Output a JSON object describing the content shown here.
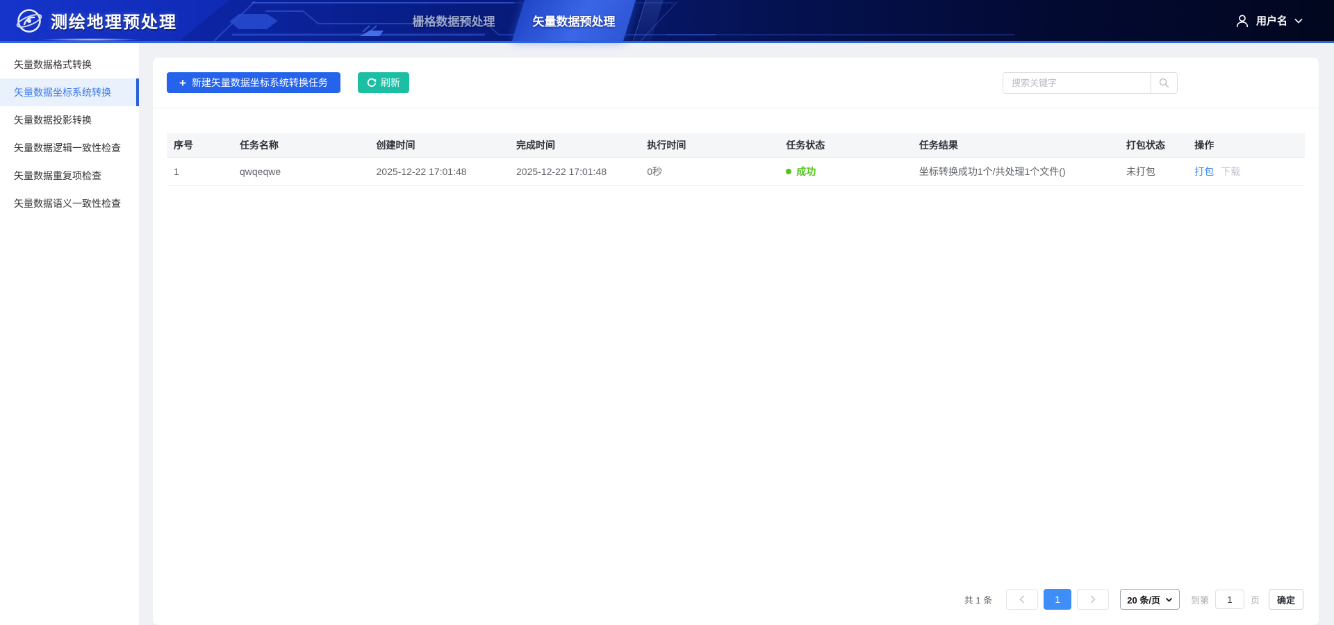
{
  "header": {
    "app_title": "测绘地理预处理",
    "tabs": [
      {
        "label": "栅格数据预处理"
      },
      {
        "label": "矢量数据预处理"
      }
    ],
    "username": "用户名"
  },
  "sidebar": {
    "active_index": 1,
    "items": [
      {
        "label": "矢量数据格式转换"
      },
      {
        "label": "矢量数据坐标系统转换"
      },
      {
        "label": "矢量数据投影转换"
      },
      {
        "label": "矢量数据逻辑一致性检查"
      },
      {
        "label": "矢量数据重复项检查"
      },
      {
        "label": "矢量数据语义一致性检查"
      }
    ]
  },
  "toolbar": {
    "new_task_label": "新建矢量数据坐标系统转换任务",
    "refresh_label": "刷新",
    "search_placeholder": "搜索关键字"
  },
  "table": {
    "columns": [
      "序号",
      "任务名称",
      "创建时间",
      "完成时间",
      "执行时间",
      "任务状态",
      "任务结果",
      "打包状态",
      "操作"
    ],
    "rows": [
      {
        "index": "1",
        "task_name": "qwqeqwe",
        "created_at": "2025-12-22 17:01:48",
        "finished_at": "2025-12-22 17:01:48",
        "duration": "0秒",
        "status": "成功",
        "result": "坐标转换成功1个/共处理1个文件()",
        "package_status": "未打包",
        "action_package": "打包",
        "action_download": "下载"
      }
    ]
  },
  "pagination": {
    "total_text": "共 1 条",
    "current_page": "1",
    "page_size_label": "20 条/页",
    "goto_prefix": "到第",
    "goto_value": "1",
    "goto_suffix": "页",
    "confirm_label": "确定"
  },
  "colors": {
    "primary_blue": "#2563eb",
    "refresh_teal": "#1cbfa4",
    "success_green": "#52c41a",
    "link_blue": "#3f8cf0",
    "active_page_blue": "#3f8ef8",
    "sidebar_active_bg": "#e9f1fd",
    "header_border_blue": "#2a67de"
  }
}
